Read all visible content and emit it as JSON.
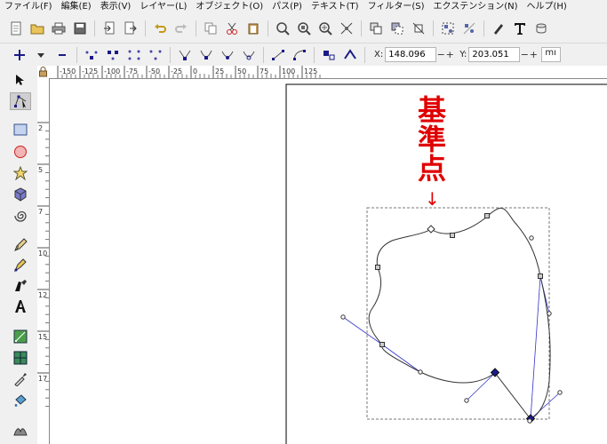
{
  "menubar": {
    "items": [
      "ファイル(F)",
      "編集(E)",
      "表示(V)",
      "レイヤー(L)",
      "オブジェクト(O)",
      "パス(P)",
      "テキスト(T)",
      "フィルター(S)",
      "エクステンション(N)",
      "ヘルプ(H)"
    ]
  },
  "toolbar1": {
    "icons": [
      "new-document",
      "open-file",
      "print",
      "import",
      "export",
      "undo",
      "redo",
      "copy",
      "cut",
      "paste",
      "zoom-selection",
      "zoom-drawing",
      "zoom-page",
      "zoom-fit",
      "duplicate",
      "clone",
      "unlink-clone",
      "group",
      "ungroup",
      "fill-stroke",
      "text-tool",
      "layers"
    ]
  },
  "toolbar2": {
    "x_label": "X:",
    "x_value": "148.096",
    "y_label": "Y:",
    "y_value": "203.051",
    "unit": "mı",
    "spin_minus": "−",
    "spin_plus": "+"
  },
  "ruler": {
    "h_ticks": [
      "-150",
      "-125",
      "-100",
      "-75",
      "-50",
      "-25",
      "0",
      "25",
      "50",
      "75",
      "100",
      "125"
    ],
    "v_ticks": [
      "2",
      "5",
      "7",
      "10",
      "12",
      "15",
      "17"
    ]
  },
  "tools": [
    "selector",
    "node-editor",
    "rectangle",
    "ellipse",
    "star",
    "3d-box",
    "spiral",
    "pencil",
    "pen",
    "calligraphy",
    "text",
    "gradient",
    "mesh",
    "dropper",
    "paint-bucket",
    "tweak"
  ],
  "annotation": {
    "text": "基準点",
    "arrow": "↓"
  },
  "colors": {
    "annotation": "#e00000",
    "handle_line": "#3333cc",
    "node_fill": "#1a1a88"
  }
}
